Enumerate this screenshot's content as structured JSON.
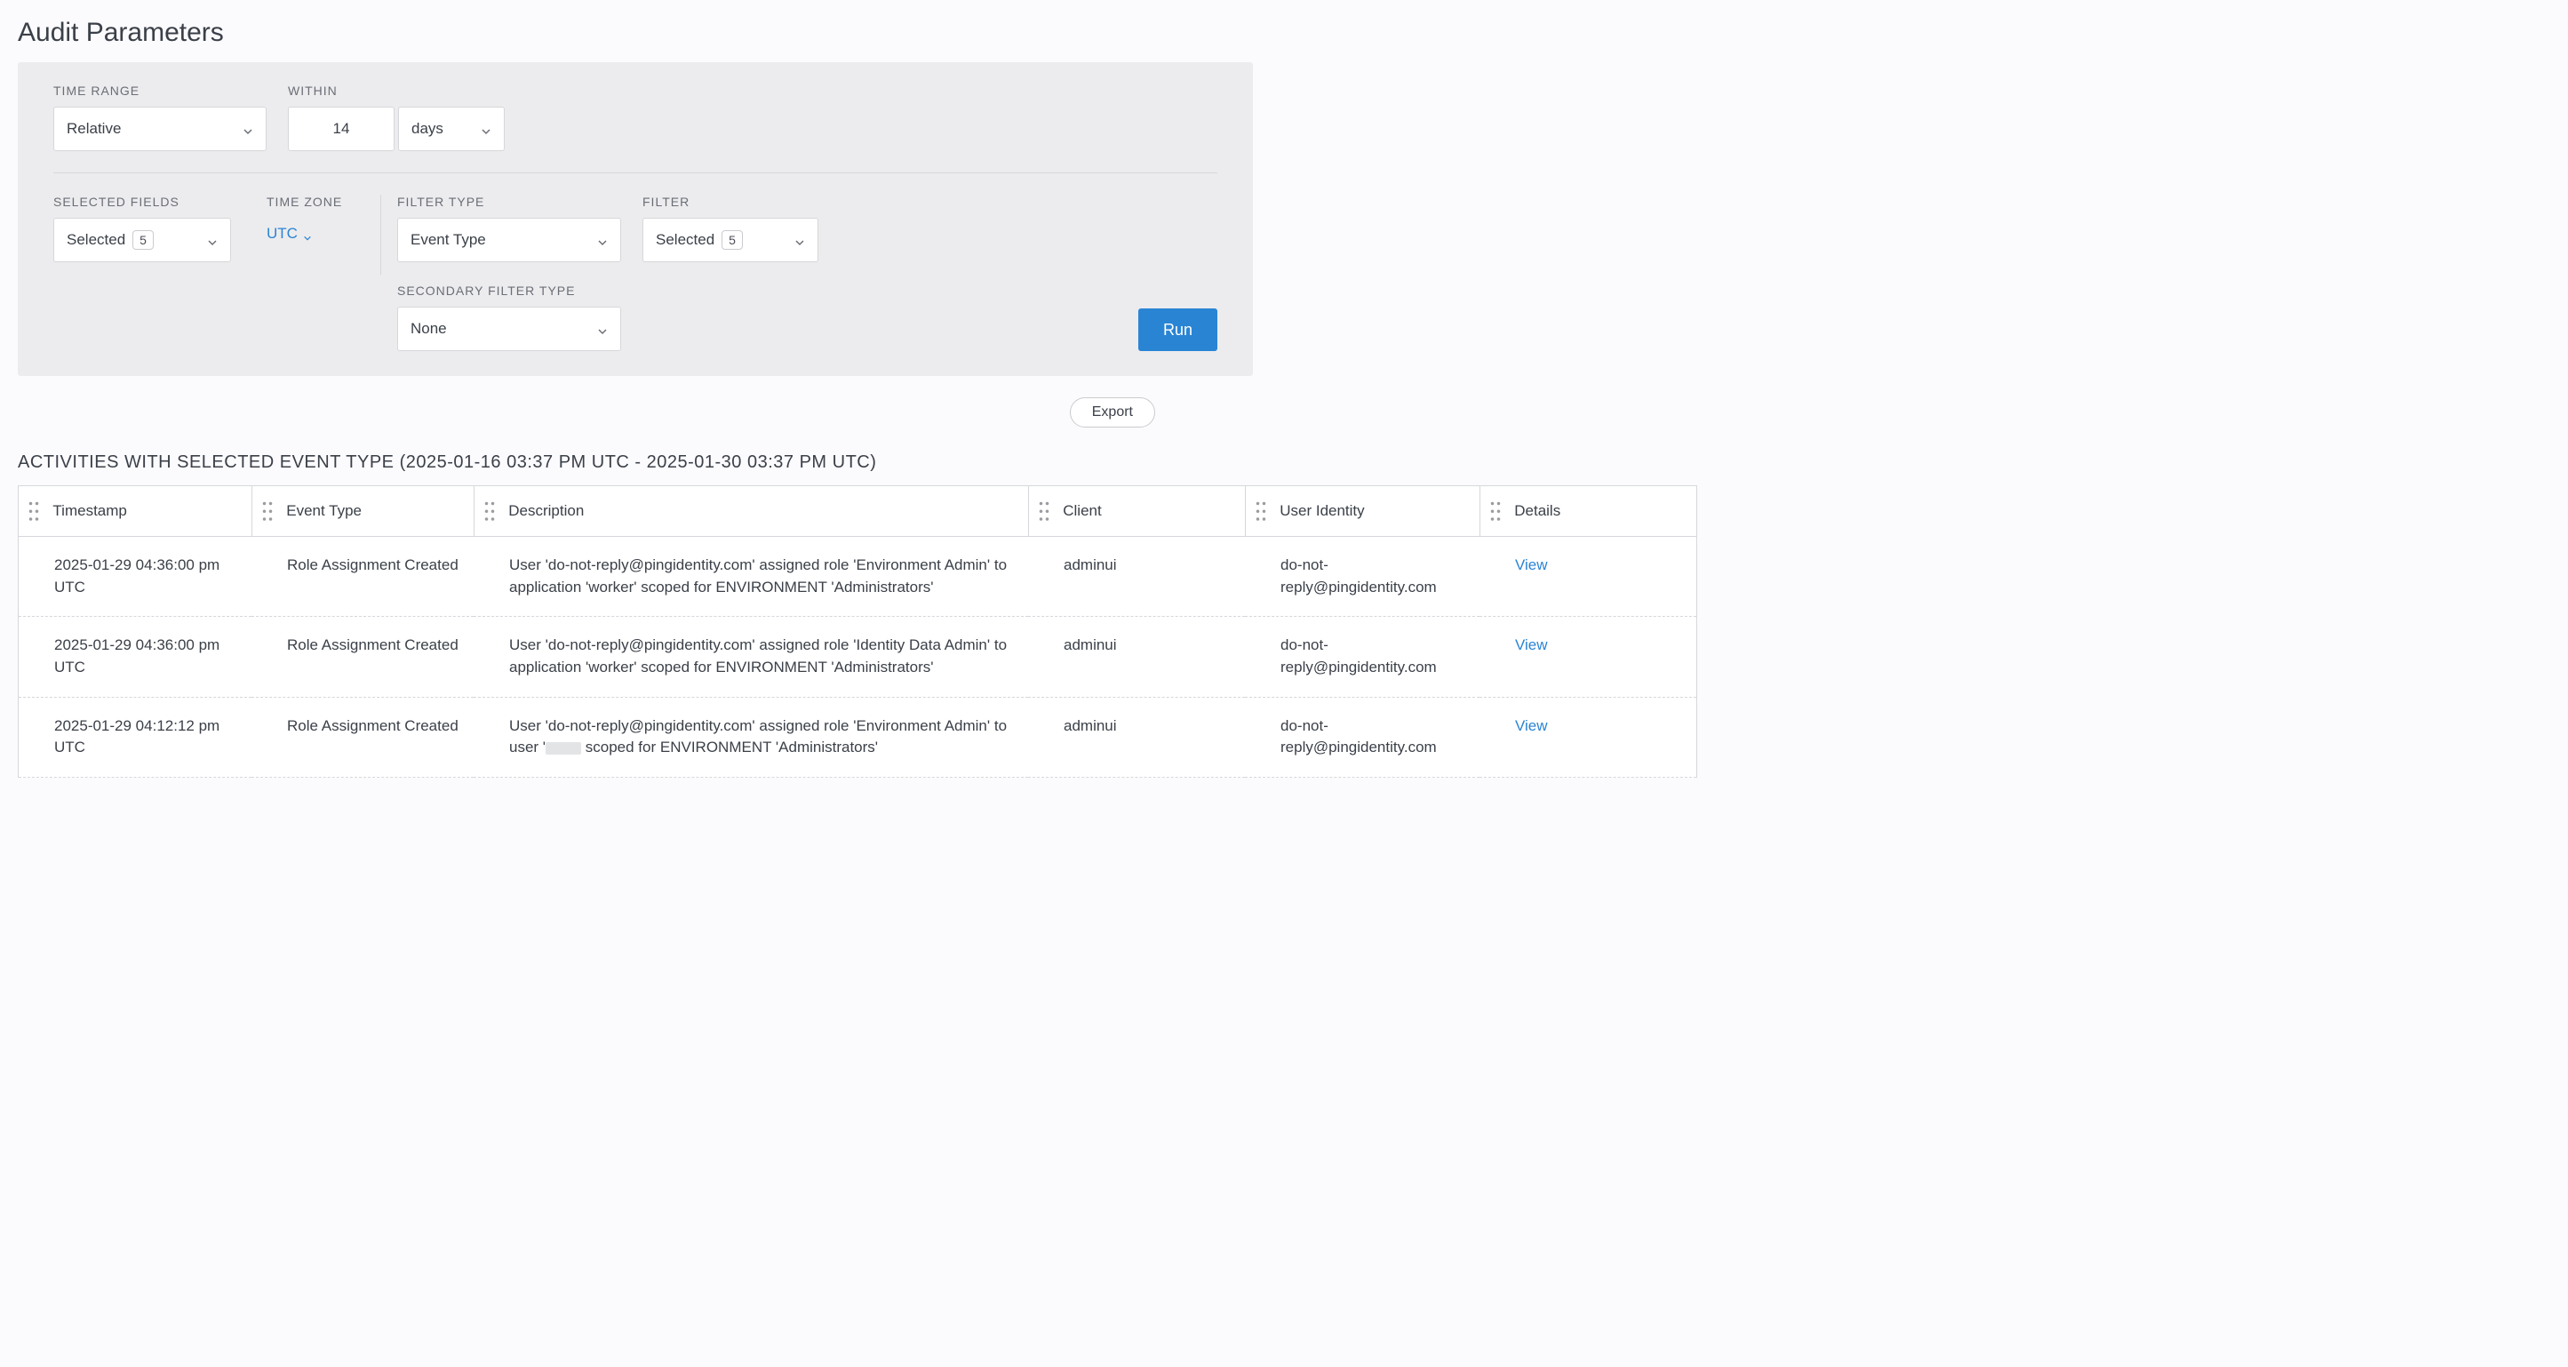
{
  "page_title": "Audit Parameters",
  "params": {
    "time_range": {
      "label": "TIME RANGE",
      "value": "Relative"
    },
    "within": {
      "label": "WITHIN",
      "value": "14",
      "unit": "days"
    },
    "selected_fields": {
      "label": "SELECTED FIELDS",
      "value": "Selected",
      "count": "5"
    },
    "time_zone": {
      "label": "TIME ZONE",
      "value": "UTC"
    },
    "filter_type": {
      "label": "FILTER TYPE",
      "value": "Event Type"
    },
    "filter": {
      "label": "FILTER",
      "value": "Selected",
      "count": "5"
    },
    "secondary_filter_type": {
      "label": "SECONDARY FILTER TYPE",
      "value": "None"
    },
    "run_label": "Run"
  },
  "export_label": "Export",
  "activities_heading": "ACTIVITIES WITH SELECTED EVENT TYPE (2025-01-16 03:37 PM UTC - 2025-01-30 03:37 PM UTC)",
  "columns": {
    "timestamp": "Timestamp",
    "event_type": "Event Type",
    "description": "Description",
    "client": "Client",
    "user_identity": "User Identity",
    "details": "Details"
  },
  "view_label": "View",
  "rows": [
    {
      "timestamp": "2025-01-29 04:36:00 pm UTC",
      "event_type": "Role Assignment Created",
      "description": "User 'do-not-reply@pingidentity.com' assigned role 'Environment Admin' to application 'worker' scoped for ENVIRONMENT 'Administrators'",
      "client": "adminui",
      "user_identity": "do-not-reply@pingidentity.com"
    },
    {
      "timestamp": "2025-01-29 04:36:00 pm UTC",
      "event_type": "Role Assignment Created",
      "description": "User 'do-not-reply@pingidentity.com' assigned role 'Identity Data Admin' to application 'worker' scoped for ENVIRONMENT 'Administrators'",
      "client": "adminui",
      "user_identity": "do-not-reply@pingidentity.com"
    },
    {
      "timestamp": "2025-01-29 04:12:12 pm UTC",
      "event_type": "Role Assignment Created",
      "description_pre": "User 'do-not-reply@pingidentity.com' assigned role 'Environment Admin' to user '",
      "description_post": " scoped for ENVIRONMENT 'Administrators'",
      "client": "adminui",
      "user_identity": "do-not-reply@pingidentity.com",
      "has_redaction": true
    }
  ]
}
